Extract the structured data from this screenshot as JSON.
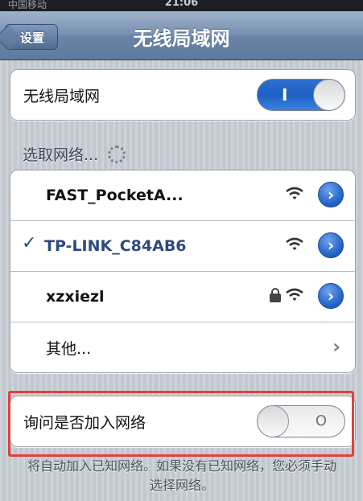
{
  "status_bar": {
    "carrier": "中国移动",
    "time": "21:06"
  },
  "nav": {
    "title": "无线局域网",
    "back_label": "设置"
  },
  "wifi_group": {
    "label": "无线局域网",
    "toggle_text": "I"
  },
  "networks_header": "选取网络...",
  "networks": [
    {
      "name": "FAST_PocketA...",
      "selected": false,
      "locked": false
    },
    {
      "name": "TP-LINK_C84AB6",
      "selected": true,
      "locked": false
    },
    {
      "name": "xzxiezl",
      "selected": false,
      "locked": true
    }
  ],
  "checkmark": "✓",
  "other_label": "其他...",
  "ask_join": {
    "label": "询问是否加入网络",
    "toggle_text": "O"
  },
  "footer_text": "将自动加入已知网络。如果没有已知网络，您必须手动选择网络。",
  "colors": {
    "accent": "#1e5fc3",
    "selected_text": "#2c4a7f",
    "highlight": "#e0413d"
  },
  "icons": [
    "back-arrow-icon",
    "wifi-icon",
    "lock-icon",
    "detail-disclosure-icon",
    "chevron-right-icon",
    "spinner-icon"
  ]
}
